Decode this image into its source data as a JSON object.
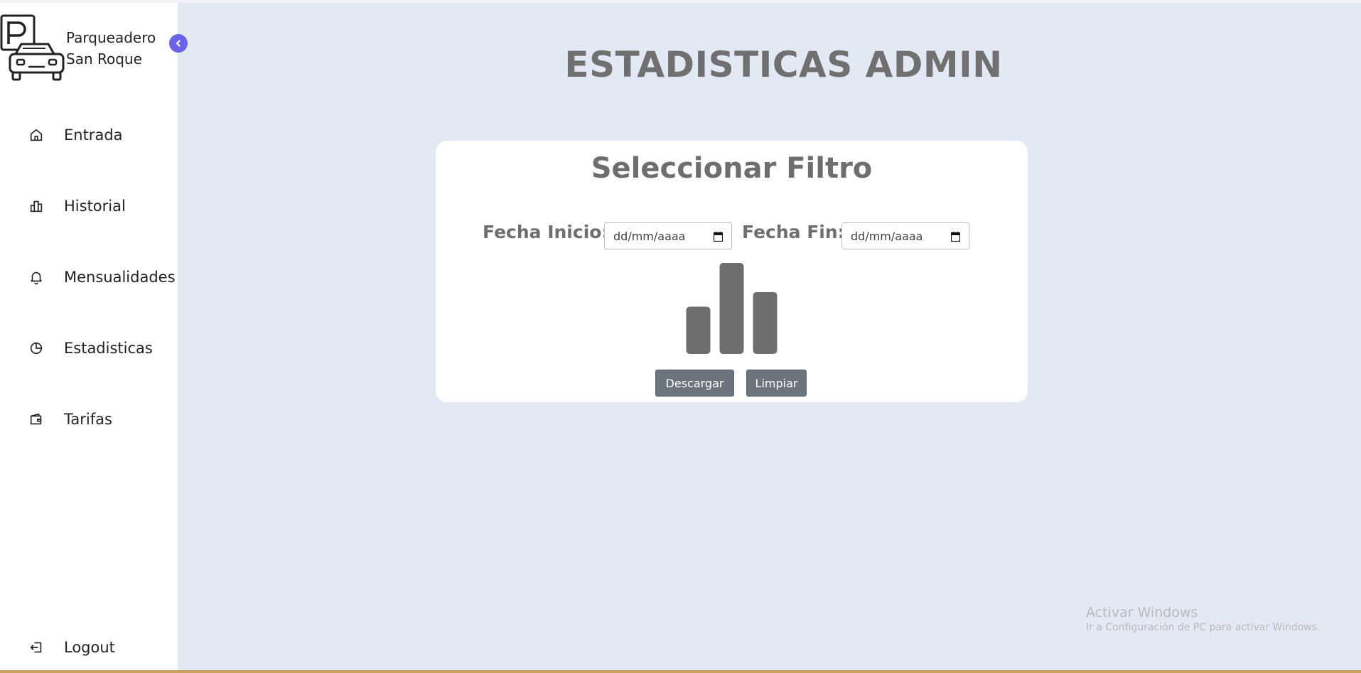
{
  "sidebar": {
    "brand": {
      "line1": "Parqueadero",
      "line2": "San Roque",
      "logo_icon": "parking-car-logo-icon"
    },
    "collapse_icon": "chevron-left-icon",
    "items": [
      {
        "label": "Entrada",
        "icon": "home-icon"
      },
      {
        "label": "Historial",
        "icon": "bar-chart-icon"
      },
      {
        "label": "Mensualidades",
        "icon": "bell-icon"
      },
      {
        "label": "Estadisticas",
        "icon": "pie-chart-icon"
      },
      {
        "label": "Tarifas",
        "icon": "wallet-icon"
      }
    ],
    "logout": {
      "label": "Logout",
      "icon": "logout-icon"
    }
  },
  "main": {
    "title": "ESTADISTICAS ADMIN",
    "card": {
      "title": "Seleccionar Filtro",
      "start_label": "Fecha Inicio:",
      "start_placeholder": "dd/mm/aaaa",
      "end_label": "Fecha Fin:",
      "end_placeholder": "dd/mm/aaaa",
      "download_label": "Descargar",
      "clear_label": "Limpiar"
    }
  },
  "colors": {
    "background": "#e3e8f5",
    "accent": "#6b63e6",
    "title_gray": "#707070",
    "button_gray": "#6c757d"
  },
  "chart_data": {
    "type": "bar",
    "categories": [
      "",
      "",
      ""
    ],
    "values": [
      52,
      100,
      68
    ],
    "ylim": [
      0,
      100
    ],
    "grid": false,
    "legend": "none"
  },
  "watermark": {
    "title": "Activar Windows",
    "subtitle": "Ir a Configuración de PC para activar Windows."
  }
}
